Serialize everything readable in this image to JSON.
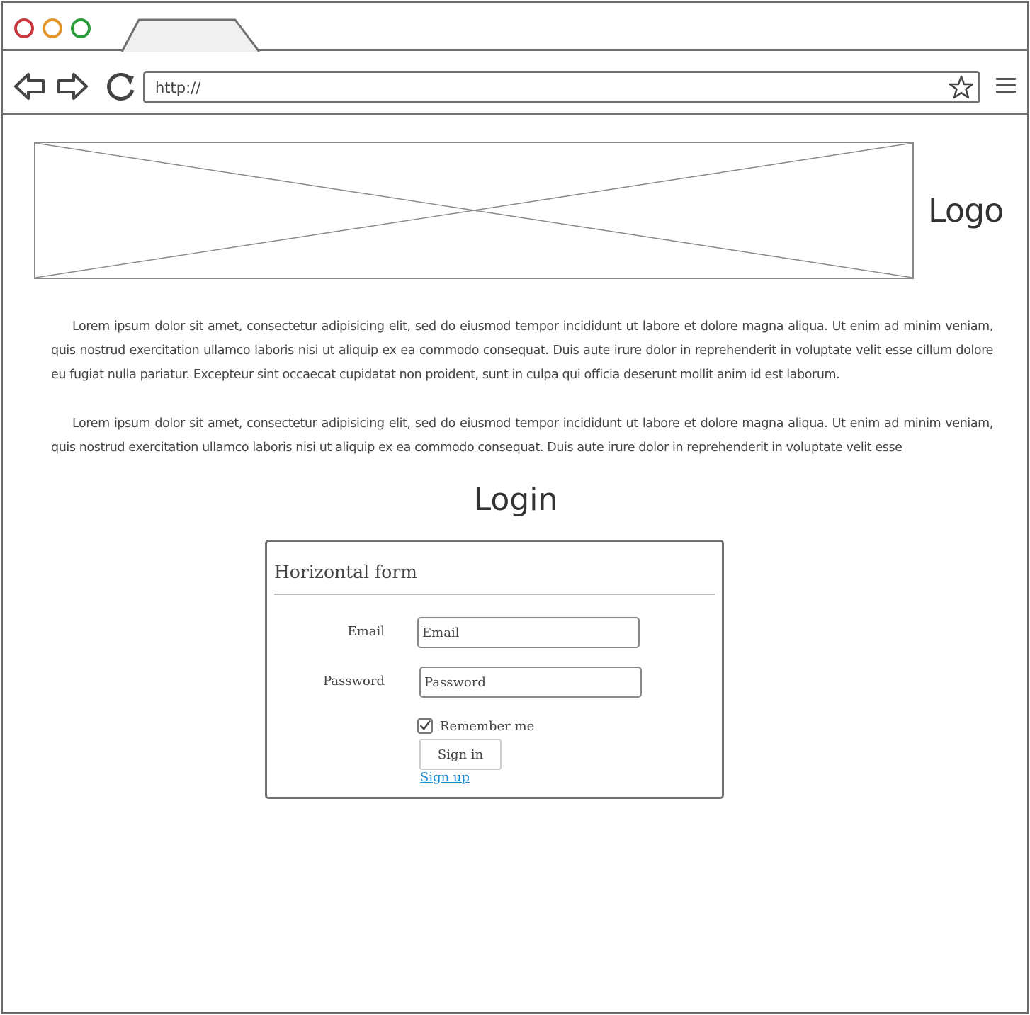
{
  "browser": {
    "url": "http://",
    "icons": {
      "back": "back-arrow-icon",
      "forward": "forward-arrow-icon",
      "reload": "reload-icon",
      "bookmark": "star-icon",
      "menu": "hamburger-menu-icon"
    },
    "traffic_lights": {
      "close": "#c8393f",
      "minimize": "#e3962c",
      "maximize": "#2a9c3a"
    }
  },
  "header": {
    "logo_text": "Logo"
  },
  "content": {
    "paragraph_1": "Lorem ipsum dolor sit amet, consectetur adipisicing elit, sed do eiusmod tempor incididunt ut labore et dolore magna aliqua. Ut enim ad minim veniam, quis nostrud exercitation ullamco laboris nisi ut aliquip ex ea commodo consequat. Duis aute irure dolor in reprehenderit in voluptate velit esse cillum dolore eu fugiat nulla pariatur. Excepteur sint occaecat cupidatat non proident, sunt in culpa qui officia deserunt mollit anim id est laborum.",
    "paragraph_2": "Lorem ipsum dolor sit amet, consectetur adipisicing elit, sed do eiusmod tempor incididunt ut labore et dolore magna aliqua. Ut enim ad minim veniam, quis nostrud exercitation ullamco laboris nisi ut aliquip ex ea commodo consequat. Duis aute irure dolor in reprehenderit in voluptate velit esse"
  },
  "login": {
    "title": "Login",
    "form_heading": "Horizontal form",
    "email_label": "Email",
    "email_placeholder": "Email",
    "password_label": "Password",
    "password_placeholder": "Password",
    "remember_label": "Remember me",
    "remember_checked": true,
    "signin_label": "Sign in",
    "signup_label": "Sign up",
    "link_color": "#1a8fd6"
  }
}
